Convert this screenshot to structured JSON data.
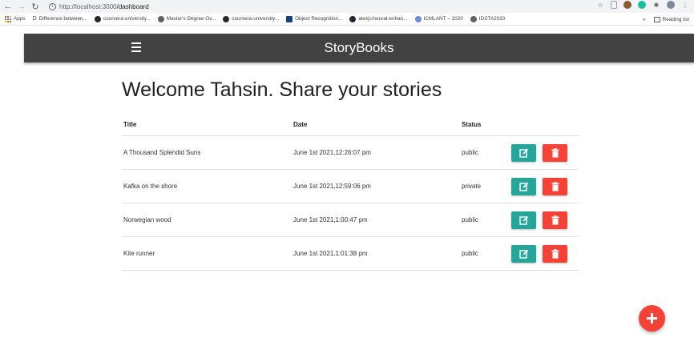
{
  "browser": {
    "url_host": "http://localhost:3000",
    "url_path": "/dashboard",
    "bookmarks": [
      {
        "label": "Apps"
      },
      {
        "label": "Difference between..."
      },
      {
        "label": "coursera-university..."
      },
      {
        "label": "Master's Degree Ov..."
      },
      {
        "label": "coursera-university..."
      },
      {
        "label": "Object Recognition..."
      },
      {
        "label": "alexjc/neural-enhan..."
      },
      {
        "label": "ICMLANT – 2020"
      },
      {
        "label": "IDSTA2020"
      }
    ],
    "more_label": "»",
    "reading_list": "Reading list"
  },
  "navbar": {
    "brand": "StoryBooks"
  },
  "page": {
    "welcome": "Welcome Tahsin. Share your stories"
  },
  "table": {
    "headers": {
      "title": "Title",
      "date": "Date",
      "status": "Status"
    },
    "rows": [
      {
        "title": "A Thousand Splendid Suns",
        "date": "June 1st 2021,12:26:07 pm",
        "status": "public"
      },
      {
        "title": "Kafka on the shore",
        "date": "June 1st 2021,12:59:06 pm",
        "status": "private"
      },
      {
        "title": "Norwegian wood",
        "date": "June 1st 2021,1:00:47 pm",
        "status": "public"
      },
      {
        "title": "Kite runner",
        "date": "June 1st 2021,1:01:38 pm",
        "status": "public"
      }
    ]
  },
  "colors": {
    "navbar": "#424242",
    "edit_button": "#26a69a",
    "delete_button": "#f44336",
    "fab": "#f44336"
  },
  "icons": {
    "menu": "hamburger-menu-icon",
    "edit": "edit-icon",
    "delete": "trash-icon",
    "add": "plus-icon"
  }
}
